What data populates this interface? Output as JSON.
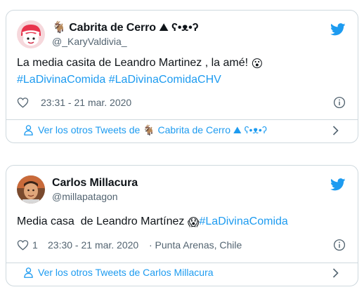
{
  "tweets": [
    {
      "display_name": "Cabrita de Cerro",
      "name_emojis": "🐐 ⛰ ʕ•ᴥ•ʔ",
      "handle": "@_KaryValdivia_",
      "text_plain": "La media casita de Leandro Martinez , la amé! ",
      "text_emoji": "😮",
      "hashtags": [
        "#LaDivinaComida",
        "#LaDivinaComidaCHV"
      ],
      "like_count": "",
      "timestamp": "23:31 - 21 mar. 2020",
      "location": "",
      "footer_prefix": "Ver los otros Tweets de",
      "footer_name": "Cabrita de Cerro",
      "footer_suffix": "ʕ•ᴥ•ʔ"
    },
    {
      "display_name": "Carlos Millacura",
      "handle": "@millapatagon",
      "text_plain": "Media casa  de Leandro Martínez ",
      "text_emoji": "😱",
      "hashtags": [
        "#LaDivinaComida"
      ],
      "like_count": "1",
      "timestamp": "23:30 - 21 mar. 2020",
      "location": "· Punta Arenas, Chile",
      "footer_text": "Ver los otros Tweets de Carlos Millacura"
    }
  ],
  "colors": {
    "link": "#1d9bf0",
    "secondary_text": "#536471",
    "border": "#cfd9de"
  }
}
